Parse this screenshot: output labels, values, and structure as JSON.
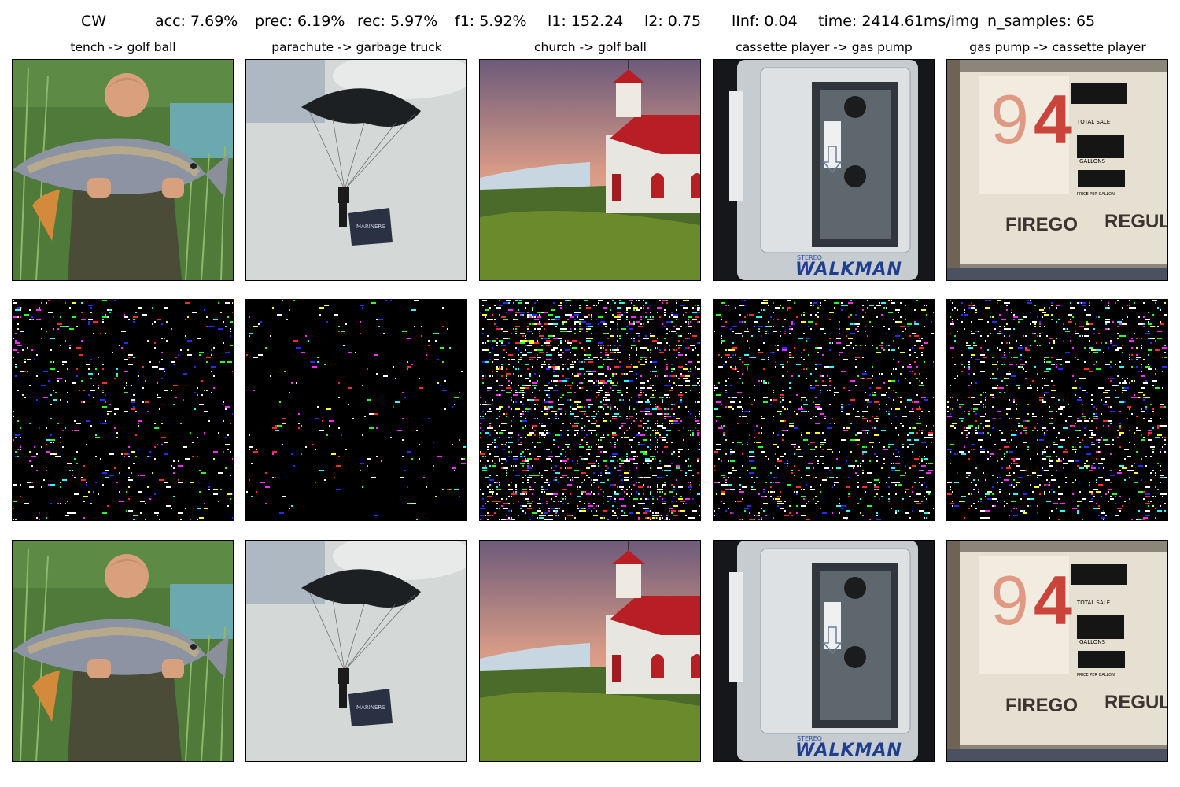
{
  "figure": {
    "attack": "CW",
    "metrics": [
      {
        "key": "acc",
        "text": "acc: 7.69%"
      },
      {
        "key": "prec",
        "text": "prec: 6.19%"
      },
      {
        "key": "rec",
        "text": "rec: 5.97%"
      },
      {
        "key": "f1",
        "text": "f1: 5.92%"
      },
      {
        "key": "l1",
        "text": "l1: 152.24"
      },
      {
        "key": "l2",
        "text": "l2: 0.75"
      },
      {
        "key": "linf",
        "text": "lInf: 0.04"
      },
      {
        "key": "time",
        "text": "time: 2414.61ms/img"
      },
      {
        "key": "n_samples",
        "text": "n_samples: 65"
      }
    ]
  },
  "columns": [
    {
      "title": "tench -> golf ball",
      "image": "photo of man holding a large carp by a lake"
    },
    {
      "title": "parachute -> garbage truck",
      "image": "parachute in cloudy sky with banner",
      "banner_text": "MARINERS"
    },
    {
      "title": "church -> golf ball",
      "image": "white church with red roof on green hill at sunset"
    },
    {
      "title": "cassette player -> gas pump",
      "image": "close-up of a Walkman cassette player",
      "brand_small": "STEREO",
      "brand_large": "WALKMAN"
    },
    {
      "title": "gas pump -> cassette player",
      "image": "old gas pump price dial",
      "big_number_1": "9",
      "big_number_2": "4",
      "label_1": "TOTAL SALE",
      "label_2": "GALLONS",
      "label_3": "PRICE PER GALLON",
      "brand_1": "FIREGO",
      "brand_2": "REGUL"
    }
  ],
  "rows": [
    "original",
    "perturbation",
    "adversarial"
  ]
}
